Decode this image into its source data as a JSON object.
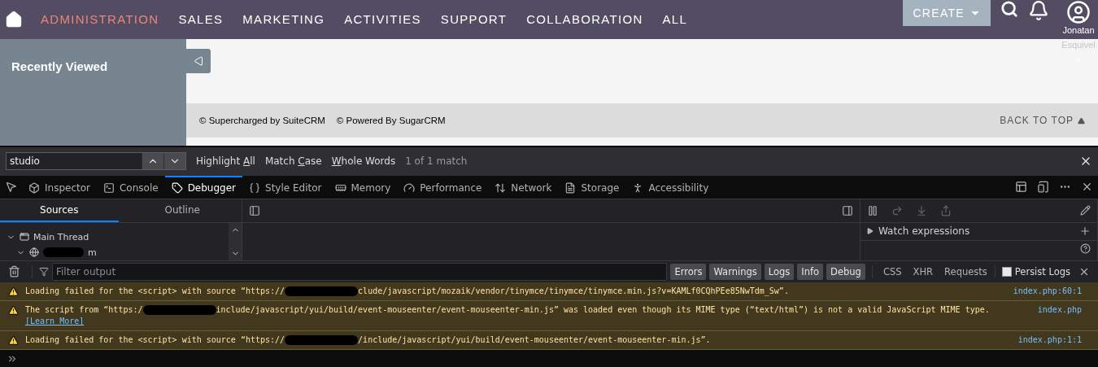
{
  "nav": {
    "items": [
      {
        "label": "ADMINISTRATION",
        "selected": true
      },
      {
        "label": "SALES",
        "selected": false
      },
      {
        "label": "MARKETING",
        "selected": false
      },
      {
        "label": "ACTIVITIES",
        "selected": false
      },
      {
        "label": "SUPPORT",
        "selected": false
      },
      {
        "label": "COLLABORATION",
        "selected": false
      },
      {
        "label": "ALL",
        "selected": false
      }
    ],
    "create": "CREATE",
    "user": [
      "Jonatan",
      "Esquivel"
    ]
  },
  "sidebar": {
    "title": "Recently Viewed"
  },
  "footer": {
    "credits": [
      "© Supercharged by SuiteCRM",
      "© Powered By SugarCRM"
    ],
    "back_to_top": "BACK TO TOP"
  },
  "find_bar": {
    "value": "studio",
    "options": [
      {
        "before": "Highlight ",
        "key": "A",
        "after": "ll"
      },
      {
        "before": "Match ",
        "key": "C",
        "after": "ase"
      },
      {
        "key": "W",
        "after": "hole Words"
      }
    ],
    "match": "1 of 1 match"
  },
  "devtools_tabs": [
    {
      "label": "Inspector",
      "selected": false
    },
    {
      "label": "Console",
      "selected": false
    },
    {
      "label": "Debugger",
      "selected": true
    },
    {
      "label": "Style Editor",
      "selected": false
    },
    {
      "label": "Memory",
      "selected": false
    },
    {
      "label": "Performance",
      "selected": false
    },
    {
      "label": "Network",
      "selected": false
    },
    {
      "label": "Storage",
      "selected": false
    },
    {
      "label": "Accessibility",
      "selected": false
    }
  ],
  "sources_tabs": [
    {
      "label": "Sources",
      "selected": true
    },
    {
      "label": "Outline",
      "selected": false
    }
  ],
  "tree": [
    {
      "label": "Main Thread",
      "expanded": true,
      "children": [
        {
          "label": "m",
          "expanded": true
        }
      ]
    }
  ],
  "watch": {
    "label": "Watch expressions",
    "expanded": false
  },
  "console": {
    "filter_placeholder": "Filter output",
    "levels": [
      {
        "label": "Errors",
        "selected": true
      },
      {
        "label": "Warnings",
        "selected": true
      },
      {
        "label": "Logs",
        "selected": true
      },
      {
        "label": "Info",
        "selected": true
      },
      {
        "label": "Debug",
        "selected": true
      }
    ],
    "types": [
      {
        "label": "CSS",
        "selected": false
      },
      {
        "label": "XHR",
        "selected": false
      },
      {
        "label": "Requests",
        "selected": false
      }
    ],
    "persist": {
      "label": "Persist Logs",
      "checked": false
    },
    "messages": [
      {
        "kind": "warning",
        "before": "Loading failed for the <script> with source “https://",
        "after": "clude/javascript/mozaik/vendor/tinymce/tinymce/tinymce.min.js?v=KAMLf0CQhPEe85NwTdm_Sw”.",
        "location": "index.php:60:1"
      },
      {
        "kind": "warning",
        "before": "The script from “https:/",
        "after": "include/javascript/yui/build/event-mouseenter/event-mouseenter-min.js” was loaded even though its MIME type (“text/html”) is not a valid JavaScript MIME type.",
        "link": "[Learn More]",
        "location": "index.php"
      },
      {
        "kind": "warning",
        "before": "Loading failed for the <script> with source “https://",
        "after": "/include/javascript/yui/build/event-mouseenter/event-mouseenter-min.js”.",
        "location": "index.php:1:1"
      }
    ]
  }
}
